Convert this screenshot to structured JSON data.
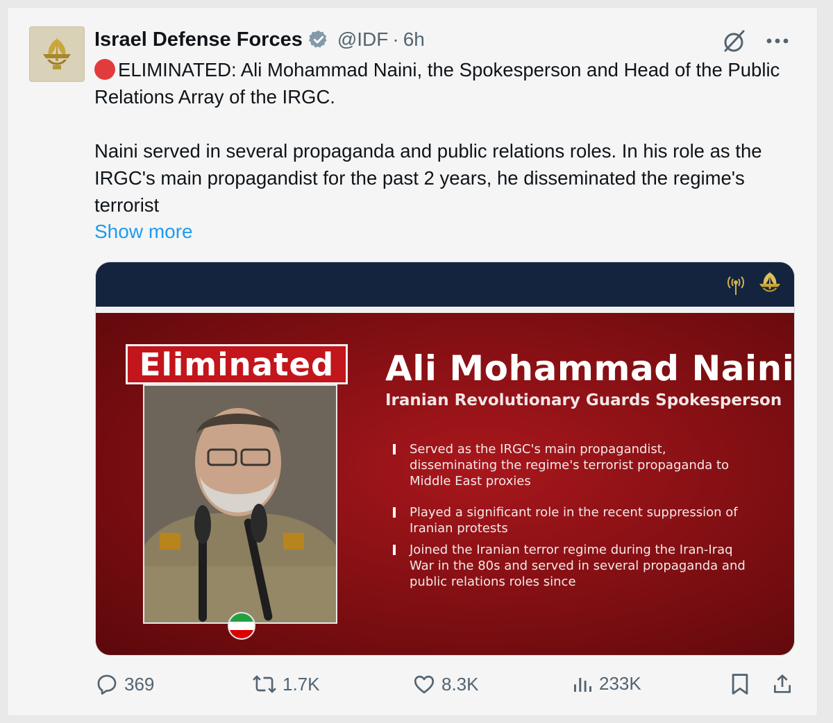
{
  "author": {
    "name": "Israel Defense Forces",
    "handle": "@IDF",
    "separator": "·",
    "time": "6h"
  },
  "tweet": {
    "line1": "ELIMINATED: Ali Mohammad Naini, the Spokesperson and Head of the Public Relations Array of the IRGC.",
    "line2": "Naini served in several propaganda and public relations roles. In his role as the IRGC's main propagandist for the past 2 years, he disseminated the regime's terrorist",
    "show_more": "Show more"
  },
  "media": {
    "badge": "Eliminated",
    "person_name": "Ali Mohammad Naini",
    "person_title": "Iranian Revolutionary Guards Spokesperson",
    "bullets": [
      "Served as the IRGC's main propagandist, disseminating the regime's terrorist propaganda to Middle East proxies",
      "Played a significant role in the recent suppression of Iranian protests",
      "Joined the Iranian terror regime during the Iran-Iraq War in the 80s and served in several propaganda and public relations roles since"
    ]
  },
  "stats": {
    "replies": "369",
    "reposts": "1.7K",
    "likes": "8.3K",
    "views": "233K"
  },
  "colors": {
    "accent": "#1d9bf0",
    "text": "#0f1419",
    "muted": "#536471",
    "banner_red": "#c3151c",
    "navy": "#14243f"
  }
}
